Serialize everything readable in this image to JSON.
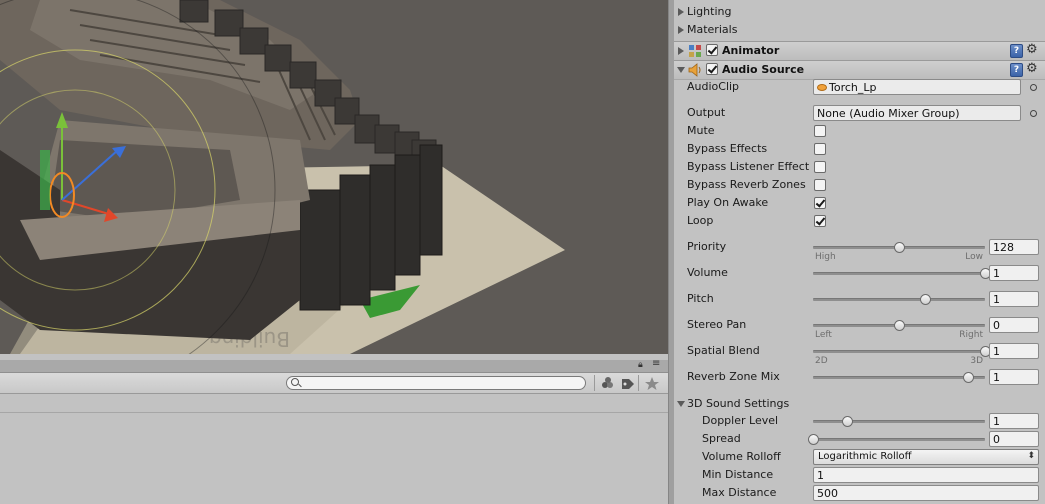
{
  "inspector": {
    "collapsed_sections": [
      {
        "label": "Lighting"
      },
      {
        "label": "Materials"
      }
    ],
    "animator": {
      "title": "Animator",
      "enabled": true
    },
    "audio_source": {
      "title": "Audio Source",
      "enabled": true,
      "audio_clip": {
        "label": "AudioClip",
        "value": "Torch_Lp"
      },
      "output": {
        "label": "Output",
        "value": "None (Audio Mixer Group)"
      },
      "toggles": [
        {
          "label": "Mute",
          "checked": false
        },
        {
          "label": "Bypass Effects",
          "checked": false
        },
        {
          "label": "Bypass Listener Effect",
          "checked": false
        },
        {
          "label": "Bypass Reverb Zones",
          "checked": false
        },
        {
          "label": "Play On Awake",
          "checked": true
        },
        {
          "label": "Loop",
          "checked": true
        }
      ],
      "sliders": [
        {
          "label": "Priority",
          "value": "128",
          "fraction": 0.5,
          "min_label": "High",
          "max_label": "Low"
        },
        {
          "label": "Volume",
          "value": "1",
          "fraction": 1.0
        },
        {
          "label": "Pitch",
          "value": "1",
          "fraction": 0.65
        },
        {
          "label": "Stereo Pan",
          "value": "0",
          "fraction": 0.5,
          "min_label": "Left",
          "max_label": "Right"
        },
        {
          "label": "Spatial Blend",
          "value": "1",
          "fraction": 1.0,
          "min_label": "2D",
          "max_label": "3D"
        },
        {
          "label": "Reverb Zone Mix",
          "value": "1",
          "fraction": 0.9
        }
      ],
      "sound_3d": {
        "label": "3D Sound Settings",
        "doppler_level": {
          "label": "Doppler Level",
          "value": "1",
          "fraction": 0.2
        },
        "spread": {
          "label": "Spread",
          "value": "0",
          "fraction": 0.0
        },
        "volume_rolloff": {
          "label": "Volume Rolloff",
          "value": "Logarithmic Rolloff"
        },
        "min_distance": {
          "label": "Min Distance",
          "value": "1"
        },
        "max_distance": {
          "label": "Max Distance",
          "value": "500"
        }
      }
    }
  },
  "project": {
    "search": {
      "value": "",
      "placeholder": ""
    }
  },
  "scene": {
    "ground_text": "Building"
  },
  "colors": {
    "panel_bg": "#c2c2c2",
    "scene_bg": "#5e5a56",
    "accent_help": "#3b63a8",
    "audio_icon": "#e8a23a"
  }
}
